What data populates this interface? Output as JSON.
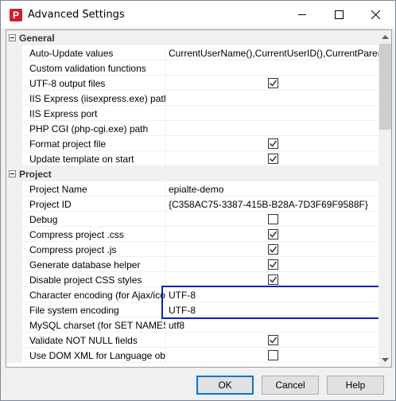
{
  "window": {
    "title": "Advanced Settings",
    "app_icon_text": "P",
    "brand_color": "#d21f2b"
  },
  "categories": {
    "general": "General",
    "project": "Project"
  },
  "general_rows": [
    {
      "name": "Auto-Update values",
      "value": "CurrentUserName(),CurrentUserID(),CurrentParentUser"
    },
    {
      "name": "Custom validation functions",
      "value": ""
    },
    {
      "name": "UTF-8 output files",
      "checkbox": true,
      "checked": true
    },
    {
      "name": "IIS Express (iisexpress.exe) path",
      "value": ""
    },
    {
      "name": "IIS Express port",
      "value": ""
    },
    {
      "name": "PHP CGI (php-cgi.exe) path",
      "value": ""
    },
    {
      "name": "Format project file",
      "checkbox": true,
      "checked": true
    },
    {
      "name": "Update template on start",
      "checkbox": true,
      "checked": true
    }
  ],
  "project_rows": [
    {
      "name": "Project Name",
      "value": "epialte-demo"
    },
    {
      "name": "Project ID",
      "value": "{C358AC75-3387-415B-B28A-7D3F69F9588F}"
    },
    {
      "name": "Debug",
      "checkbox": true,
      "checked": false
    },
    {
      "name": "Compress project .css",
      "checkbox": true,
      "checked": true
    },
    {
      "name": "Compress project .js",
      "checkbox": true,
      "checked": true
    },
    {
      "name": "Generate database helper",
      "checkbox": true,
      "checked": true
    },
    {
      "name": "Disable project CSS styles",
      "checkbox": true,
      "checked": true
    },
    {
      "name": "Character encoding (for Ajax/iconv)",
      "value": "UTF-8"
    },
    {
      "name": "File system encoding",
      "value": "UTF-8"
    },
    {
      "name": "MySQL charset (for SET NAMES)",
      "value": "utf8"
    },
    {
      "name": "Validate NOT NULL fields",
      "checkbox": true,
      "checked": true
    },
    {
      "name": "Use DOM XML for Language object",
      "checkbox": true,
      "checked": false
    }
  ],
  "buttons": {
    "ok": "OK",
    "cancel": "Cancel",
    "help": "Help"
  },
  "colors": {
    "highlight_border": "#1020c0",
    "default_button_border": "#0078d7"
  }
}
